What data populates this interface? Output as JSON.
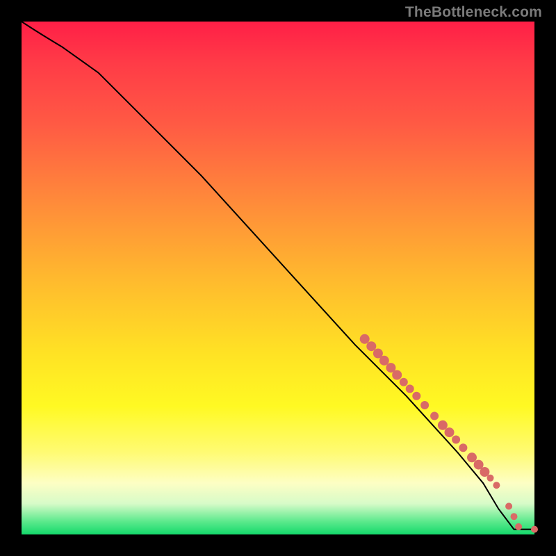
{
  "watermark": "TheBottleneck.com",
  "chart_data": {
    "type": "line",
    "title": "",
    "xlabel": "",
    "ylabel": "",
    "xlim": [
      0,
      100
    ],
    "ylim": [
      0,
      100
    ],
    "note": "Axes are unlabeled in the source image; x read left→right 0–100, y read bottom→top 0–100. Values estimated from pixel positions.",
    "series": [
      {
        "name": "curve",
        "x": [
          0,
          3,
          8,
          15,
          25,
          35,
          45,
          55,
          65,
          75,
          85,
          90,
          93,
          96,
          100
        ],
        "y": [
          100,
          98,
          95,
          90,
          80,
          70,
          59,
          48,
          37,
          27,
          16,
          10,
          5,
          1,
          1
        ]
      }
    ],
    "scatter": {
      "name": "cluster",
      "points": [
        {
          "x": 66.9,
          "y": 38.1,
          "r": 7
        },
        {
          "x": 68.2,
          "y": 36.7,
          "r": 7
        },
        {
          "x": 69.5,
          "y": 35.3,
          "r": 7
        },
        {
          "x": 70.7,
          "y": 33.9,
          "r": 7
        },
        {
          "x": 72.0,
          "y": 32.5,
          "r": 7
        },
        {
          "x": 73.2,
          "y": 31.1,
          "r": 7
        },
        {
          "x": 74.5,
          "y": 29.7,
          "r": 6
        },
        {
          "x": 75.7,
          "y": 28.4,
          "r": 6
        },
        {
          "x": 77.0,
          "y": 27.0,
          "r": 6
        },
        {
          "x": 78.6,
          "y": 25.2,
          "r": 6
        },
        {
          "x": 80.5,
          "y": 23.1,
          "r": 6
        },
        {
          "x": 82.1,
          "y": 21.3,
          "r": 7
        },
        {
          "x": 83.4,
          "y": 19.9,
          "r": 7
        },
        {
          "x": 84.7,
          "y": 18.5,
          "r": 6
        },
        {
          "x": 86.1,
          "y": 16.9,
          "r": 6
        },
        {
          "x": 87.8,
          "y": 15.0,
          "r": 7
        },
        {
          "x": 89.1,
          "y": 13.6,
          "r": 7
        },
        {
          "x": 90.3,
          "y": 12.2,
          "r": 7
        },
        {
          "x": 91.4,
          "y": 11.0,
          "r": 5
        },
        {
          "x": 92.6,
          "y": 9.6,
          "r": 5
        },
        {
          "x": 95.0,
          "y": 5.5,
          "r": 5
        },
        {
          "x": 96.0,
          "y": 3.5,
          "r": 5
        },
        {
          "x": 96.9,
          "y": 1.5,
          "r": 5
        },
        {
          "x": 100.0,
          "y": 1.0,
          "r": 5
        }
      ]
    }
  }
}
